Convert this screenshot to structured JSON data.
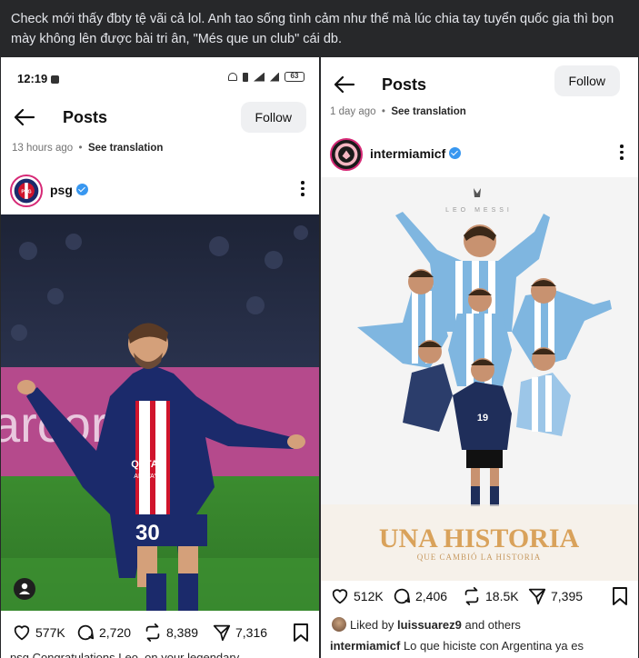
{
  "post_caption": "Check mới thấy đbty tệ vãi cả lol. Anh tao sống tình cảm như thế mà lúc chia tay tuyển quốc gia thì bọn mày không lên được bài tri ân, \"Més que un club\" cái db.",
  "left": {
    "status": {
      "time": "12:19",
      "battery": "63"
    },
    "title": "Posts",
    "follow_label": "Follow",
    "time_ago": "13 hours ago",
    "see_translation": "See translation",
    "username": "psg",
    "likes": "577K",
    "comments": "2,720",
    "reposts": "8,389",
    "shares": "7,316",
    "caption_cut": "psg Congratulations Leo, on your legendary"
  },
  "right": {
    "title": "Posts",
    "follow_label": "Follow",
    "time_ago": "1 day ago",
    "see_translation": "See translation",
    "username": "intermiamicf",
    "poster_top": "LEO MESSI",
    "poster_title": "UNA HISTORIA",
    "poster_subtitle": "QUE CAMBIÓ LA HISTORIA",
    "likes": "512K",
    "comments": "2,406",
    "reposts": "18.5K",
    "shares": "7,395",
    "liked_by_prefix": "Liked by",
    "liked_by_user": "luissuarez9",
    "liked_by_suffix": "and others",
    "caption_user": "intermiamicf",
    "caption_text": "Lo que hiciste con Argentina ya es"
  },
  "colors": {
    "psg_navy": "#1b2a6b",
    "psg_red": "#d0142c",
    "argentina_sky": "#7fb6e0",
    "poster_gold": "#d9a25b",
    "verified_blue": "#3897f0"
  }
}
